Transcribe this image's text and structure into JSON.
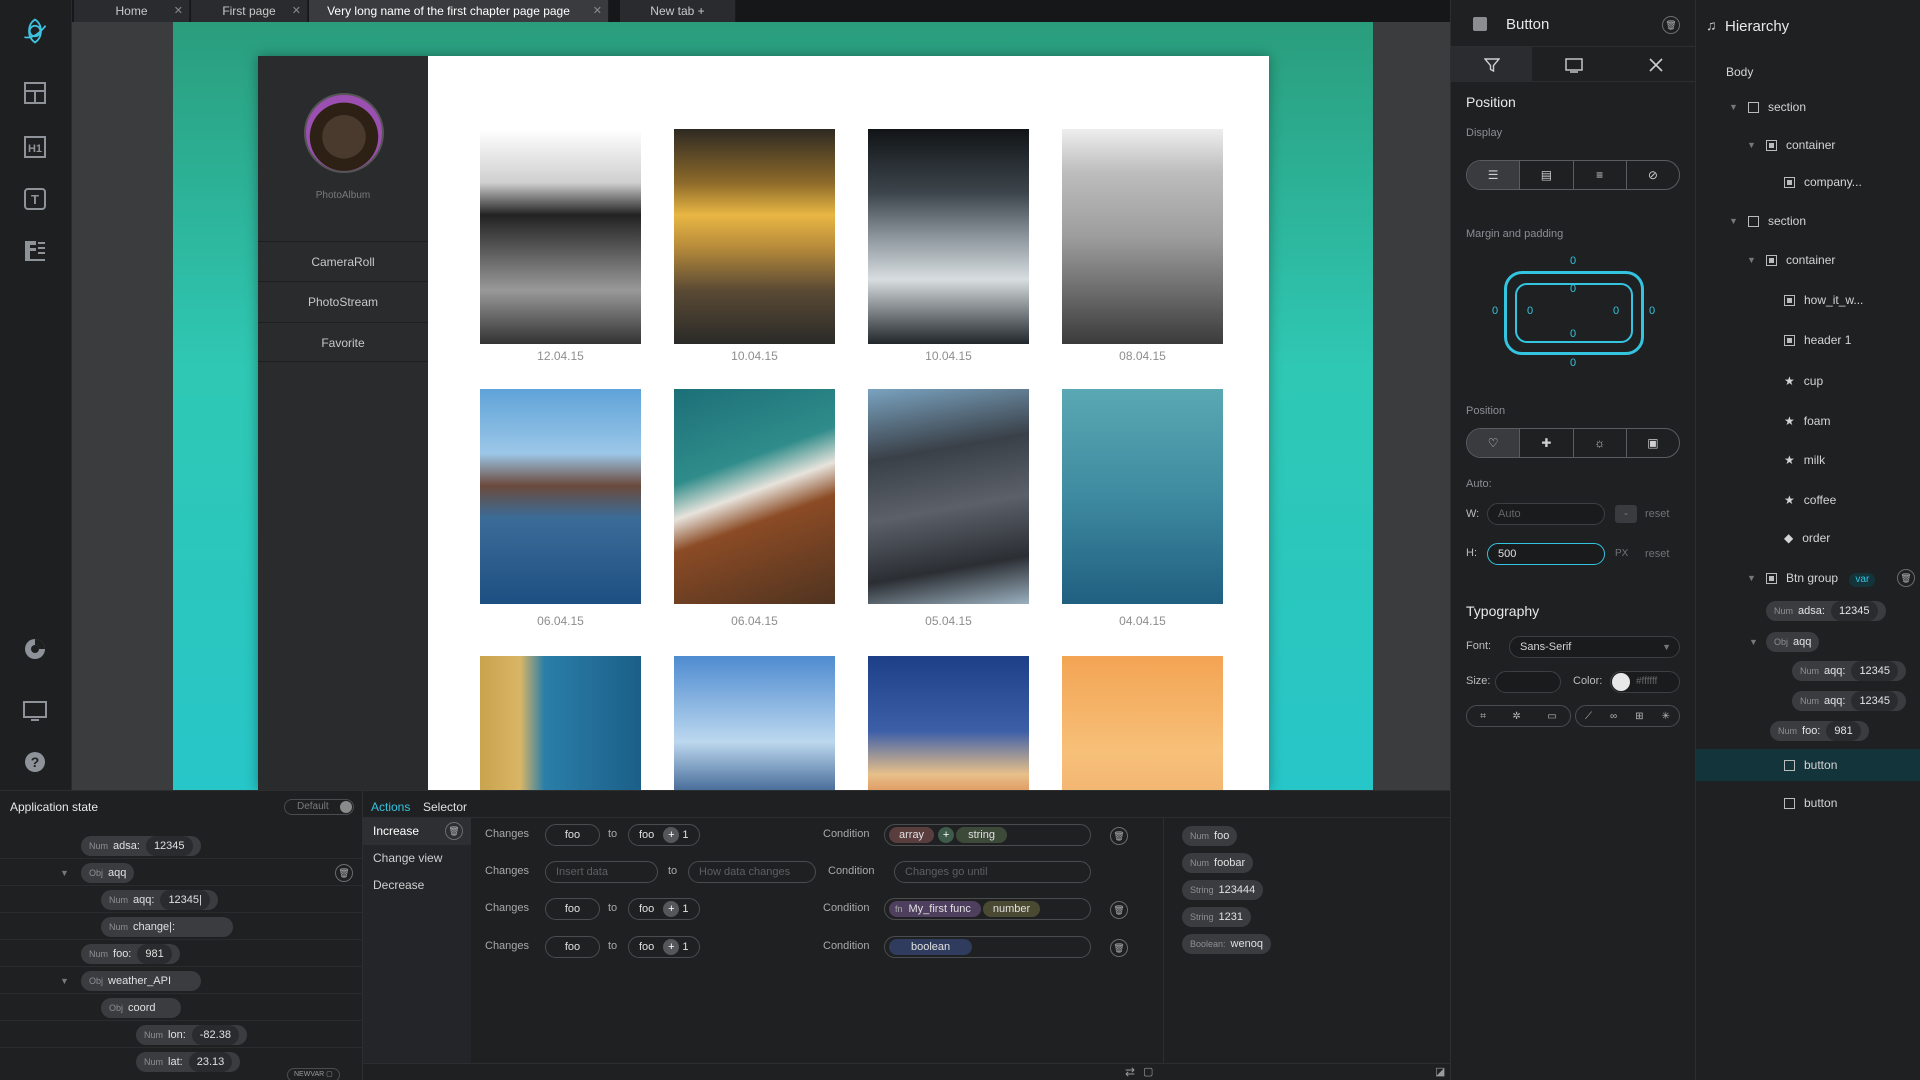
{
  "tabs": [
    {
      "label": "Home"
    },
    {
      "label": "First page"
    },
    {
      "label": "Very long name of the first chapter page page"
    },
    {
      "label": "New tab"
    }
  ],
  "album": {
    "title": "PhotoAlbum",
    "nav": [
      "CameraRoll",
      "PhotoStream",
      "Favorite"
    ],
    "dates": [
      "12.04.15",
      "10.04.15",
      "10.04.15",
      "08.04.15",
      "06.04.15",
      "06.04.15",
      "05.04.15",
      "04.04.15"
    ]
  },
  "props": {
    "title": "Button",
    "position_title": "Position",
    "display_label": "Display",
    "margin_label": "Margin and padding",
    "margin_values": {
      "mt": "0",
      "pt": "0",
      "ml": "0",
      "pl": "0",
      "pr": "0",
      "mr": "0",
      "pb": "0",
      "mb": "0"
    },
    "position_label": "Position",
    "auto_label": "Auto:",
    "w_label": "W:",
    "w_placeholder": "Auto",
    "w_unit": "-",
    "reset": "reset",
    "h_label": "H:",
    "h_value": "500",
    "h_unit": "PX",
    "typography_title": "Typography",
    "font_label": "Font:",
    "font_value": "Sans-Serif",
    "size_label": "Size:",
    "color_label": "Color:",
    "color_value": "#ffffff"
  },
  "hierarchy": {
    "title": "Hierarchy",
    "body": "Body",
    "rows": [
      {
        "label": "section"
      },
      {
        "label": "container"
      },
      {
        "label": "company..."
      },
      {
        "label": "section"
      },
      {
        "label": "container"
      },
      {
        "label": "how_it_w..."
      },
      {
        "label": "header 1"
      },
      {
        "label": "cup"
      },
      {
        "label": "foam"
      },
      {
        "label": "milk"
      },
      {
        "label": "coffee"
      },
      {
        "label": "order"
      },
      {
        "label": "Btn group"
      },
      {
        "label": "button"
      },
      {
        "label": "button"
      }
    ],
    "var_badge": "var",
    "vars": [
      {
        "type": "Num",
        "key": "adsa:",
        "value": "12345"
      },
      {
        "type": "Obj",
        "key": "aqq"
      },
      {
        "type": "Num",
        "key": "aqq:",
        "value": "12345"
      },
      {
        "type": "Num",
        "key": "aqq:",
        "value": "12345"
      },
      {
        "type": "Num",
        "key": "foo:",
        "value": "981"
      }
    ]
  },
  "app_state": {
    "title": "Application state",
    "toggle_label": "Default",
    "rows": [
      {
        "type": "Num",
        "key": "adsa:",
        "value": "12345"
      },
      {
        "type": "Obj",
        "key": "aqq"
      },
      {
        "type": "Num",
        "key": "aqq:",
        "value": "12345|"
      },
      {
        "type": "Num",
        "key": "change|:"
      },
      {
        "type": "Num",
        "key": "foo:",
        "value": "981"
      },
      {
        "type": "Obj",
        "key": "weather_API"
      },
      {
        "type": "Obj",
        "key": "coord"
      },
      {
        "type": "Num",
        "key": "lon:",
        "value": "-82.38"
      },
      {
        "type": "Num",
        "key": "lat:",
        "value": "23.13"
      }
    ],
    "newvar": "NEWVAR"
  },
  "actions": {
    "tab_actions": "Actions",
    "tab_selector": "Selector",
    "list": [
      "Increase",
      "Change view",
      "Decrease"
    ],
    "changes": "Changes",
    "to": "to",
    "condition": "Condition",
    "row1": {
      "a": "foo",
      "b": "foo",
      "n": "1",
      "c1": "array",
      "c2": "string"
    },
    "row2": {
      "insert": "Insert data",
      "how": "How data changes",
      "until": "Changes go until"
    },
    "row3": {
      "a": "foo",
      "b": "foo",
      "n": "1",
      "fn_tag": "fn",
      "c1": "My_first func",
      "c2": "number"
    },
    "row4": {
      "a": "foo",
      "b": "foo",
      "n": "1",
      "c1": "boolean"
    }
  },
  "vars_list": [
    {
      "type": "Num",
      "value": "foo"
    },
    {
      "type": "Num",
      "value": "foobar"
    },
    {
      "type": "String",
      "value": "123444"
    },
    {
      "type": "String",
      "value": "1231"
    },
    {
      "type": "Boolean:",
      "value": "wenoq"
    }
  ]
}
